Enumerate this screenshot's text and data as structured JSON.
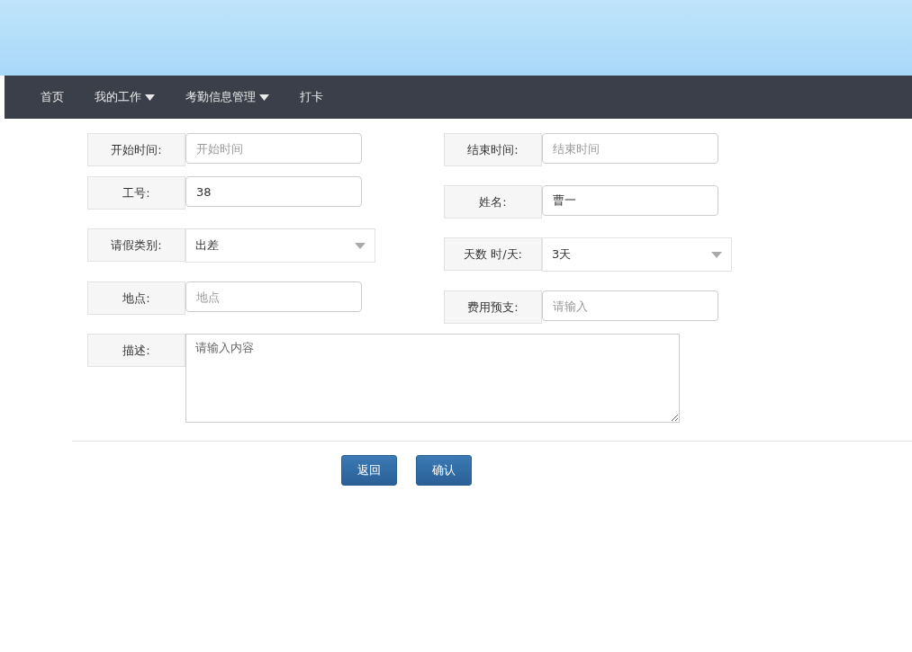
{
  "nav": {
    "items": [
      {
        "label": "首页",
        "has_menu": false
      },
      {
        "label": "我的工作",
        "has_menu": true
      },
      {
        "label": "考勤信息管理",
        "has_menu": true
      },
      {
        "label": "打卡",
        "has_menu": false
      }
    ]
  },
  "form": {
    "left": [
      {
        "label": "开始时间:",
        "kind": "text",
        "placeholder": "开始时间"
      },
      {
        "label": "工号:",
        "kind": "text",
        "value": "38"
      },
      {
        "label": "请假类别:",
        "kind": "select",
        "value": "出差"
      },
      {
        "label": "地点:",
        "kind": "text",
        "placeholder": "地点"
      }
    ],
    "right": [
      {
        "label": "结束时间:",
        "kind": "text",
        "placeholder": "结束时间"
      },
      {
        "label": "姓名:",
        "kind": "text",
        "value": "曹一"
      },
      {
        "label": "天数 时/天:",
        "kind": "select",
        "value": "3天"
      },
      {
        "label": "费用预支:",
        "kind": "text",
        "placeholder": "请输入"
      }
    ],
    "description": {
      "label": "描述:",
      "placeholder": "请输入内容"
    }
  },
  "buttons": [
    "返回",
    "确认"
  ]
}
